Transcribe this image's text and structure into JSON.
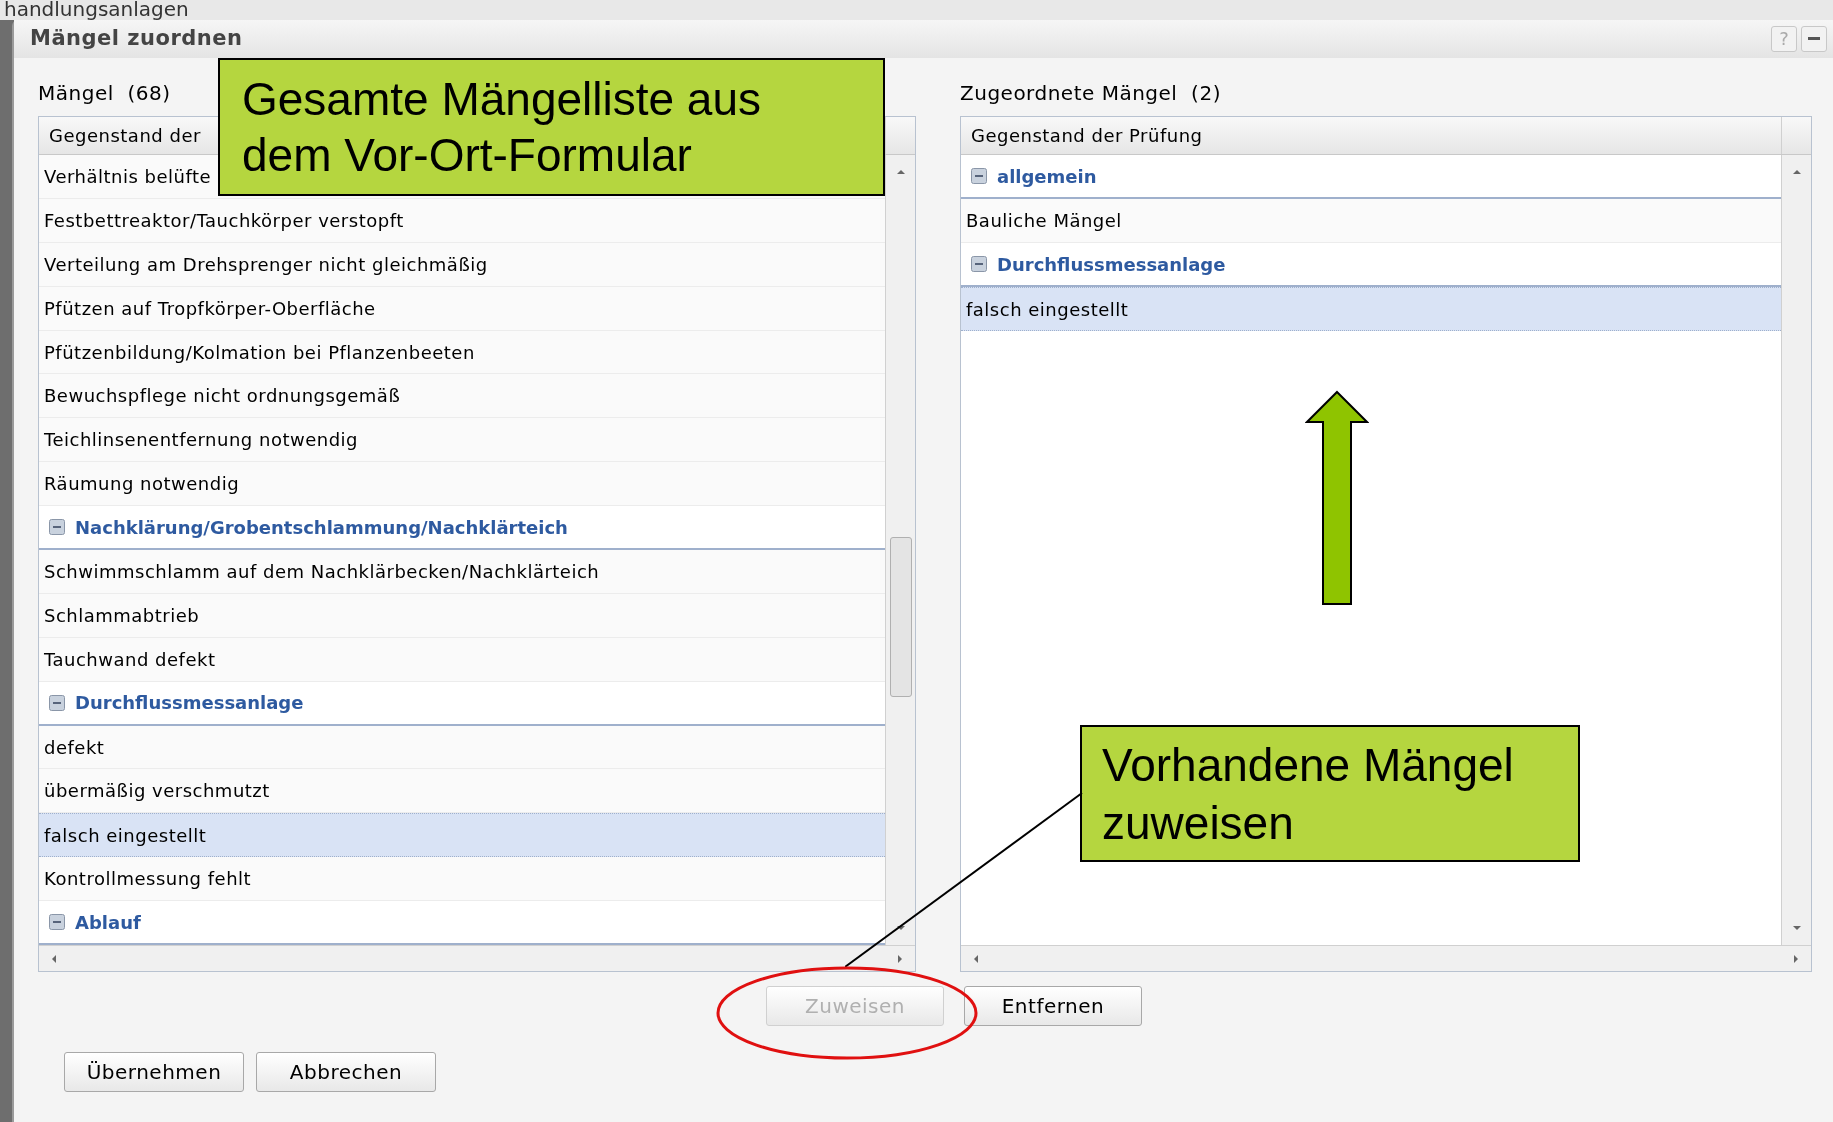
{
  "background": {
    "text": "handlungsanlagen"
  },
  "dialog": {
    "title": "Mängel zuordnen",
    "help": "?"
  },
  "left": {
    "label": "Mängel  (68)",
    "column": "Gegenstand der",
    "items": [
      {
        "kind": "row",
        "text": "Verhältnis belüfte",
        "selected": false
      },
      {
        "kind": "row",
        "text": "Festbettreaktor/Tauchkörper verstopft",
        "selected": false
      },
      {
        "kind": "row",
        "text": "Verteilung am Drehsprenger nicht gleichmäßig",
        "selected": false
      },
      {
        "kind": "row",
        "text": "Pfützen auf Tropfkörper-Oberfläche",
        "selected": false
      },
      {
        "kind": "row",
        "text": "Pfützenbildung/Kolmation bei Pflanzenbeeten",
        "selected": false
      },
      {
        "kind": "row",
        "text": "Bewuchspflege nicht ordnungsgemäß",
        "selected": false
      },
      {
        "kind": "row",
        "text": "Teichlinsenentfernung notwendig",
        "selected": false
      },
      {
        "kind": "row",
        "text": "Räumung notwendig",
        "selected": false
      },
      {
        "kind": "group",
        "text": "Nachklärung/Grobentschlammung/Nachklärteich",
        "expanded": true
      },
      {
        "kind": "row",
        "text": "Schwimmschlamm auf dem Nachklärbecken/Nachklärteich",
        "selected": false
      },
      {
        "kind": "row",
        "text": "Schlammabtrieb",
        "selected": false
      },
      {
        "kind": "row",
        "text": "Tauchwand defekt",
        "selected": false
      },
      {
        "kind": "group",
        "text": "Durchflussmessanlage",
        "expanded": true
      },
      {
        "kind": "row",
        "text": "defekt",
        "selected": false
      },
      {
        "kind": "row",
        "text": "übermäßig verschmutzt",
        "selected": false
      },
      {
        "kind": "row",
        "text": "falsch eingestellt",
        "selected": true
      },
      {
        "kind": "row",
        "text": "Kontrollmessung fehlt",
        "selected": false
      },
      {
        "kind": "group",
        "text": "Ablauf",
        "expanded": true
      }
    ]
  },
  "right": {
    "label": "Zugeordnete Mängel  (2)",
    "column": "Gegenstand der Prüfung",
    "items": [
      {
        "kind": "group",
        "text": "allgemein",
        "expanded": true
      },
      {
        "kind": "row",
        "text": "Bauliche Mängel",
        "selected": false
      },
      {
        "kind": "group",
        "text": "Durchflussmessanlage",
        "expanded": true
      },
      {
        "kind": "row",
        "text": "falsch eingestellt",
        "selected": true
      }
    ]
  },
  "actions": [
    {
      "label": "Zuweisen",
      "disabled": true
    },
    {
      "label": "Entfernen",
      "disabled": false
    }
  ],
  "footer_buttons": [
    {
      "label": "Übernehmen"
    },
    {
      "label": "Abbrechen"
    }
  ],
  "callouts": [
    {
      "text": "Gesamte Mängelliste aus dem Vor-Ort-Formular"
    },
    {
      "text": "Vorhandene Mängel zuweisen"
    }
  ]
}
